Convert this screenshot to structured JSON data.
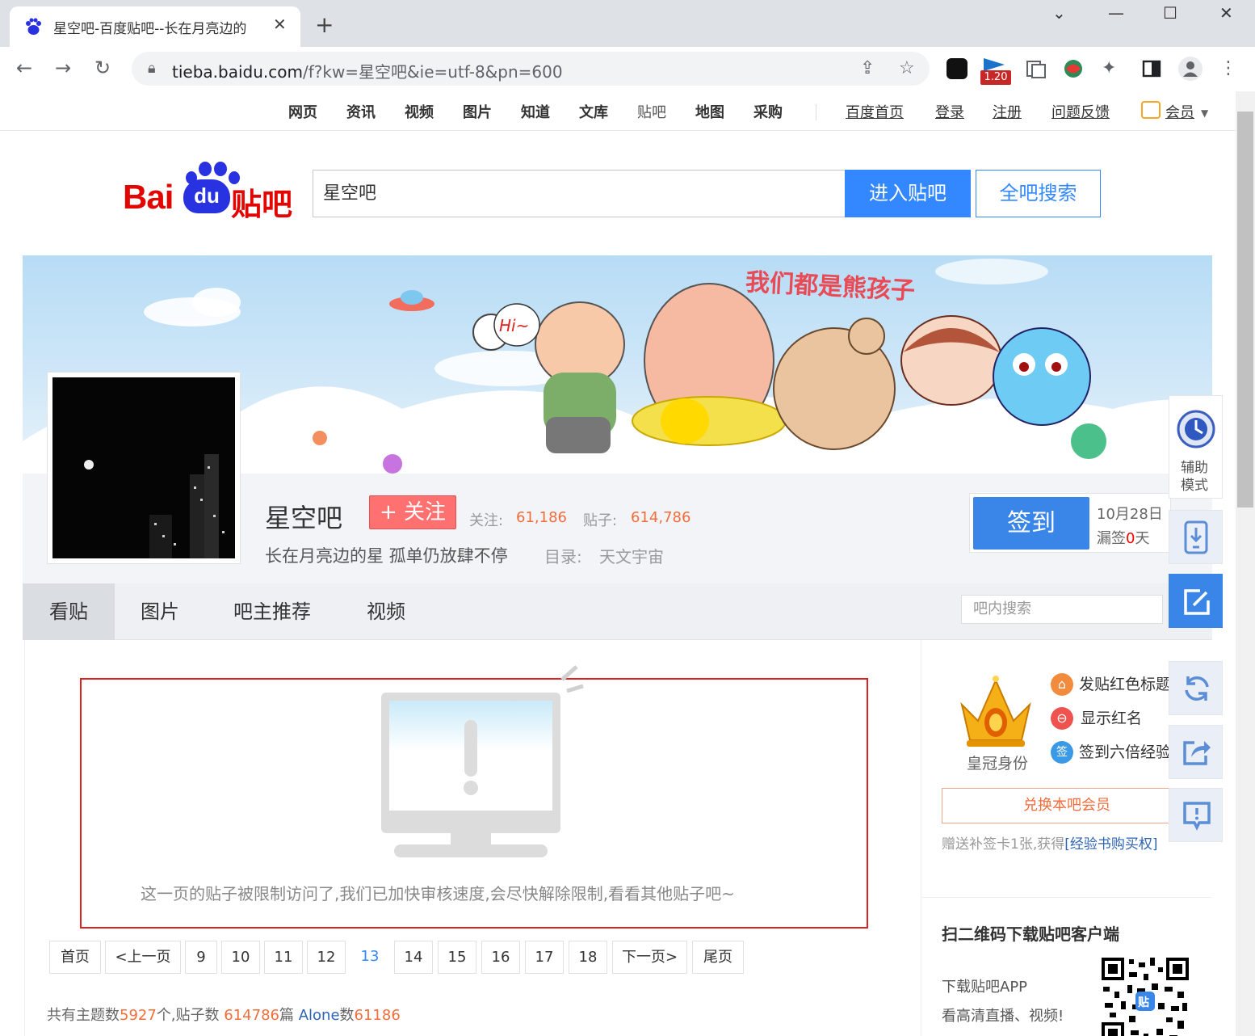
{
  "browser": {
    "tab_title": "星空吧-百度贴吧--长在月亮边的",
    "tab_close": "✕",
    "new_tab": "+",
    "url_host": "tieba.baidu.com",
    "url_path": "/f?kw=星空吧&ie=utf-8&pn=600",
    "extension_badge": "1.20",
    "window_controls": [
      "⌄",
      "—",
      "☐",
      "✕"
    ]
  },
  "topnav": {
    "items": [
      "网页",
      "资讯",
      "视频",
      "图片",
      "知道",
      "文库",
      "贴吧",
      "地图",
      "采购"
    ],
    "links": [
      "百度首页",
      "登录",
      "注册",
      "问题反馈"
    ],
    "member": "会员"
  },
  "logo": {
    "bai": "Bai",
    "du": "du",
    "tieba": "贴吧"
  },
  "search": {
    "value": "星空吧",
    "enter_label": "进入贴吧",
    "all_label": "全吧搜索"
  },
  "banner": {
    "slogan_art": "我们都是熊孩子",
    "hi": "Hi~"
  },
  "forum": {
    "name": "星空吧",
    "follow_label": "+ 关注",
    "follow_count_label": "关注:",
    "follow_count": "61,186",
    "posts_label": "贴子:",
    "posts_count": "614,786",
    "slogan": "长在月亮边的星 孤单仍放肆不停",
    "dir_label": "目录:",
    "dir_value": "天文宇宙"
  },
  "signin": {
    "label": "签到",
    "date": "10月28日",
    "miss_prefix": "漏签",
    "miss_days": "0",
    "miss_suffix": "天"
  },
  "tabs": [
    "看贴",
    "图片",
    "吧主推荐",
    "视频"
  ],
  "in_search_placeholder": "吧内搜索",
  "restricted": {
    "message": "这一页的贴子被限制访问了,我们已加快审核速度,会尽快解除限制,看看其他贴子吧~"
  },
  "pagination": {
    "first": "首页",
    "prev": "<上一页",
    "pages": [
      "9",
      "10",
      "11",
      "12",
      "13",
      "14",
      "15",
      "16",
      "17",
      "18"
    ],
    "current": "13",
    "next": "下一页>",
    "last": "尾页"
  },
  "footer": {
    "topics_label": "共有主题数",
    "topics": "5927",
    "topics_unit": "个,贴子数 ",
    "posts": "614786",
    "posts_unit": "篇 ",
    "members_label": "Alone",
    "members_mid": "数",
    "members": "61186"
  },
  "sidebar": {
    "crown_label": "皇冠身份",
    "perks": [
      {
        "text": "发贴红色标题",
        "icon": "bookmark-icon",
        "glyph": "⌂"
      },
      {
        "text": "显示红名",
        "icon": "name-tag-icon",
        "glyph": "⊖"
      },
      {
        "text": "签到六倍经验",
        "icon": "sign-icon",
        "glyph": "签"
      }
    ],
    "redeem_label": "兑换本吧会员",
    "gift_text": "赠送补签卡1张,获得",
    "gift_link": "[经验书购买权]",
    "qr_title": "扫二维码下载贴吧客户端",
    "qr_line1": "下载贴吧APP",
    "qr_line2": "看高清直播、视频!",
    "qr_badge": "贴"
  },
  "floatbar": {
    "assist_label_1": "辅助",
    "assist_label_2": "模式"
  },
  "colors": {
    "accent_blue": "#3388ff",
    "signin_blue": "#3a85e8",
    "follow_red": "#ff7070",
    "stat_orange": "#f16d3c",
    "logo_red": "#e10602",
    "logo_blue": "#2932e1",
    "restrict_border": "#e02020"
  }
}
